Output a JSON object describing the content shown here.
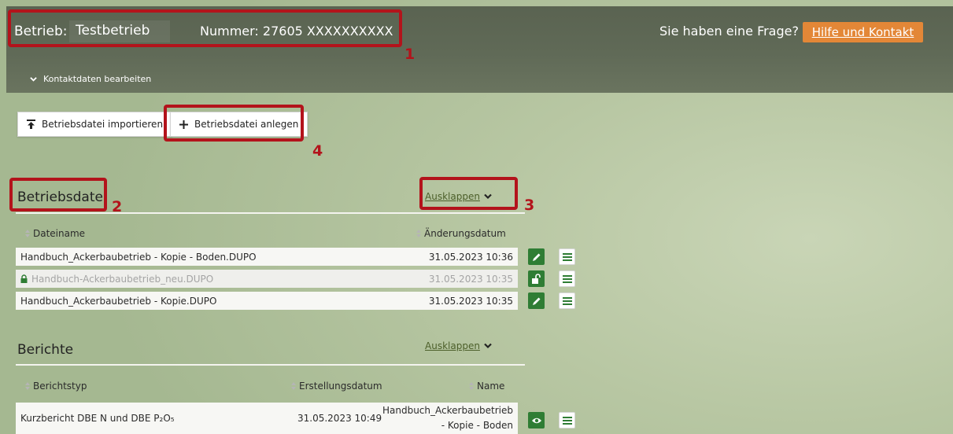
{
  "header": {
    "betrieb_label": "Betrieb:",
    "betrieb_value": "Testbetrieb",
    "nummer_label": "Nummer: 27605  XXXXXXXXXX",
    "frage": "Sie haben eine Frage?",
    "hilfe_button": "Hilfe und Kontakt",
    "kontakt_toggle": "Kontaktdaten bearbeiten"
  },
  "actions": {
    "import_label": "Betriebsdatei importieren",
    "anlegen_label": "Betriebsdatei anlegen"
  },
  "annotations": [
    "1",
    "2",
    "3",
    "4"
  ],
  "betriebsdatei": {
    "title": "Betriebsdatei",
    "ausklappen": "Ausklappen",
    "columns": [
      "Dateiname",
      "Änderungsdatum"
    ],
    "rows": [
      {
        "name": "Handbuch_Ackerbaubetrieb - Kopie - Boden.DUPO",
        "date": "31.05.2023 10:36",
        "locked": false
      },
      {
        "name": "Handbuch-Ackerbaubetrieb_neu.DUPO",
        "date": "31.05.2023 10:35",
        "locked": true
      },
      {
        "name": "Handbuch_Ackerbaubetrieb - Kopie.DUPO",
        "date": "31.05.2023 10:35",
        "locked": false
      }
    ]
  },
  "berichte": {
    "title": "Berichte",
    "ausklappen": "Ausklappen",
    "columns": [
      "Berichtstyp",
      "Erstellungsdatum",
      "Name"
    ],
    "rows": [
      {
        "typ": "Kurzbericht DBE N und DBE P₂O₅",
        "datum": "31.05.2023 10:49",
        "name_line1": "Handbuch_Ackerbaubetrieb",
        "name_line2": "- Kopie - Boden"
      }
    ]
  },
  "colors": {
    "header_bg": "#606a57",
    "accent_orange": "#e38737",
    "annotation_red": "#b3131b",
    "icon_green": "#2f7d34"
  }
}
